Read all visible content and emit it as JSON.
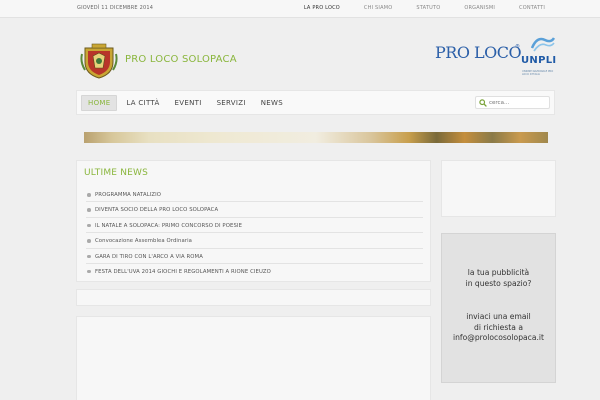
{
  "topbar": {
    "date": "GIOVEDÌ 11 DICEMBRE 2014",
    "links": [
      "LA PRO LOCO",
      "CHI SIAMO",
      "STATUTO",
      "ORGANISMI",
      "CONTATTI"
    ]
  },
  "header": {
    "site_title": "PRO LOCO SOLOPACA",
    "partner_logo_text": "PRO LOCO",
    "partner_logo_reg": "®",
    "partner_sub_logo": "UNPLI",
    "partner_sub_caption": "UNIONE NAZIONALE PRO LOCO D'ITALIA"
  },
  "nav": {
    "items": [
      "HOME",
      "LA CITTÀ",
      "EVENTI",
      "SERVIZI",
      "NEWS"
    ],
    "active_index": 0,
    "search_placeholder": "cerca..."
  },
  "news": {
    "title": "ULTIME NEWS",
    "items": [
      "PROGRAMMA NATALIZIO",
      "DIVENTA SOCIO DELLA PRO LOCO SOLOPACA",
      "IL NATALE A SOLOPACA: PRIMO CONCORSO DI POESIE",
      "Convocazione Assemblea Ordinaria",
      "GARA DI TIRO CON L'ARCO A VIA ROMA",
      "FESTA DELL'UVA 2014 GIOCHI E REGOLAMENTI A RIONE CIEUZO"
    ]
  },
  "ad": {
    "line1": "la tua pubblicità",
    "line2": "in questo spazio?",
    "line3": "inviaci una email",
    "line4": "di richiesta a",
    "line5": "info@prolocosolopaca.it"
  },
  "colors": {
    "accent_green": "#8ab63d",
    "brand_blue": "#2b5fa8"
  },
  "icons": {
    "search": "search-icon",
    "crest": "town-crest-icon",
    "news_bullet": "bullet-icon"
  }
}
